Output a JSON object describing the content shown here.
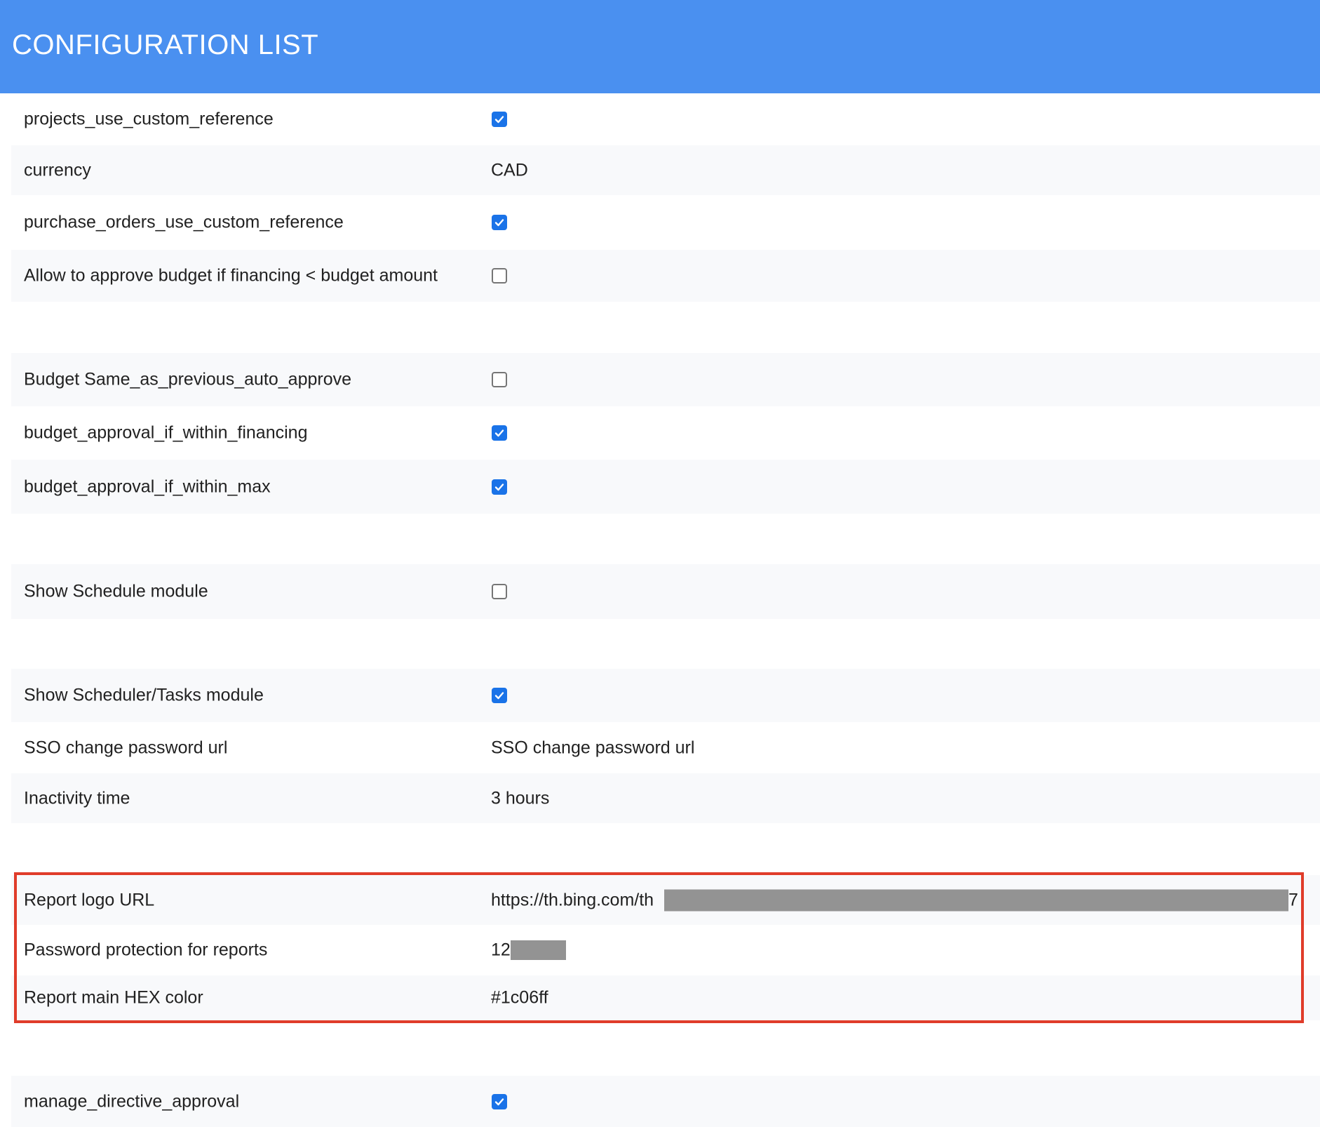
{
  "header": {
    "title": "CONFIGURATION LIST"
  },
  "rows": [
    {
      "label": "projects_use_custom_reference",
      "type": "checkbox",
      "checked": true
    },
    {
      "label": "currency",
      "type": "text",
      "value": "CAD"
    },
    {
      "label": "purchase_orders_use_custom_reference",
      "type": "checkbox",
      "checked": true
    },
    {
      "label": "Allow to approve budget if financing < budget amount",
      "type": "checkbox",
      "checked": false
    },
    {
      "label": "Budget Same_as_previous_auto_approve",
      "type": "checkbox",
      "checked": false
    },
    {
      "label": "budget_approval_if_within_financing",
      "type": "checkbox",
      "checked": true
    },
    {
      "label": "budget_approval_if_within_max",
      "type": "checkbox",
      "checked": true
    },
    {
      "label": "Show Schedule module",
      "type": "checkbox",
      "checked": false
    },
    {
      "label": "Show Scheduler/Tasks module",
      "type": "checkbox",
      "checked": true
    },
    {
      "label": "SSO change password url",
      "type": "text",
      "value": "SSO change password url"
    },
    {
      "label": "Inactivity time",
      "type": "text",
      "value": "3 hours"
    },
    {
      "label": "Report logo URL",
      "type": "text",
      "value": "https://th.bing.com/th",
      "trailing": "7",
      "redacted": true
    },
    {
      "label": "Password protection for reports",
      "type": "text",
      "value": "12",
      "redacted": true
    },
    {
      "label": "Report main HEX color",
      "type": "text",
      "value": "#1c06ff"
    },
    {
      "label": "manage_directive_approval",
      "type": "checkbox",
      "checked": true
    }
  ],
  "colors": {
    "header_bg": "#4a90f0",
    "checkbox_checked": "#1a73e8",
    "highlight_border": "#e03c2a",
    "redaction": "#939393"
  }
}
